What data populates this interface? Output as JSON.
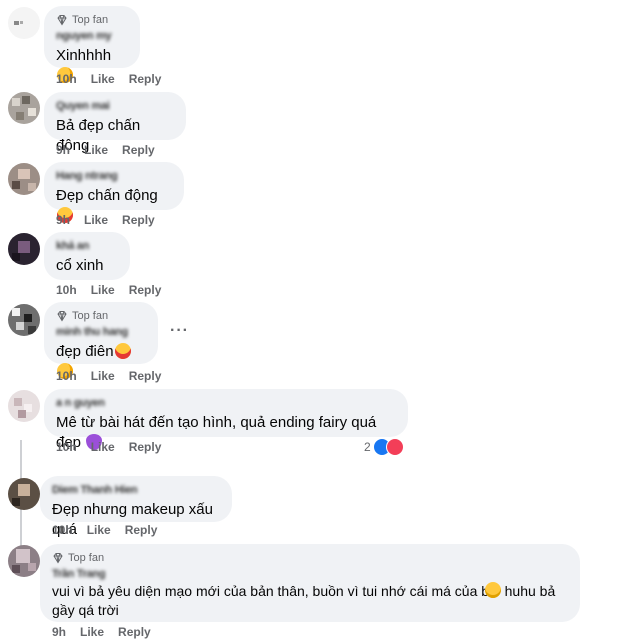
{
  "comments": [
    {
      "top_fan": "Top fan",
      "name": "nguyen my",
      "text": "Xinhhhh",
      "time": "10h",
      "like": "Like",
      "reply": "Reply"
    },
    {
      "name": "Quyen mai",
      "text": "Bả đẹp chấn động",
      "time": "9h",
      "like": "Like",
      "reply": "Reply"
    },
    {
      "name": "Hang ntrang",
      "text": "Đẹp chấn động",
      "time": "9h",
      "like": "Like",
      "reply": "Reply"
    },
    {
      "name": "khả an",
      "text": "cổ xinh",
      "time": "10h",
      "like": "Like",
      "reply": "Reply"
    },
    {
      "top_fan": "Top fan",
      "name": "minh thu hang",
      "text": "đẹp điên",
      "time": "10h",
      "like": "Like",
      "reply": "Reply",
      "more": "···"
    },
    {
      "name": "a n guyen",
      "text": "Mê từ bài hát đến tạo hình, quả ending fairy quá đẹp",
      "time": "10h",
      "like": "Like",
      "reply": "Reply",
      "reactions_count": "2"
    },
    {
      "name": "Diem Thanh Hien",
      "text": "Đẹp nhưng makeup xấu quá",
      "time": "10h",
      "like": "Like",
      "reply": "Reply"
    },
    {
      "top_fan": "Top fan",
      "name": "Trần Trang",
      "text": "vui vì bả yêu diện mạo mới của bản thân, buồn vì tui nhớ cái má của bả  huhu bả\ngầy qá trời",
      "time": "9h",
      "like": "Like",
      "reply": "Reply"
    }
  ],
  "icons": {
    "diamond": "diamond-icon",
    "heart_face": "smiling-face-with-hearts-emoji",
    "heart_eyes": "heart-eyes-emoji",
    "purple_heart": "purple-heart-emoji",
    "sad": "disappointed-face-emoji",
    "like": "like-reaction-icon",
    "love": "love-reaction-icon"
  },
  "colors": {
    "bubble": "#f0f2f5",
    "meta": "#65676b",
    "like_blue": "#1877f2",
    "love_red": "#f33e58"
  }
}
